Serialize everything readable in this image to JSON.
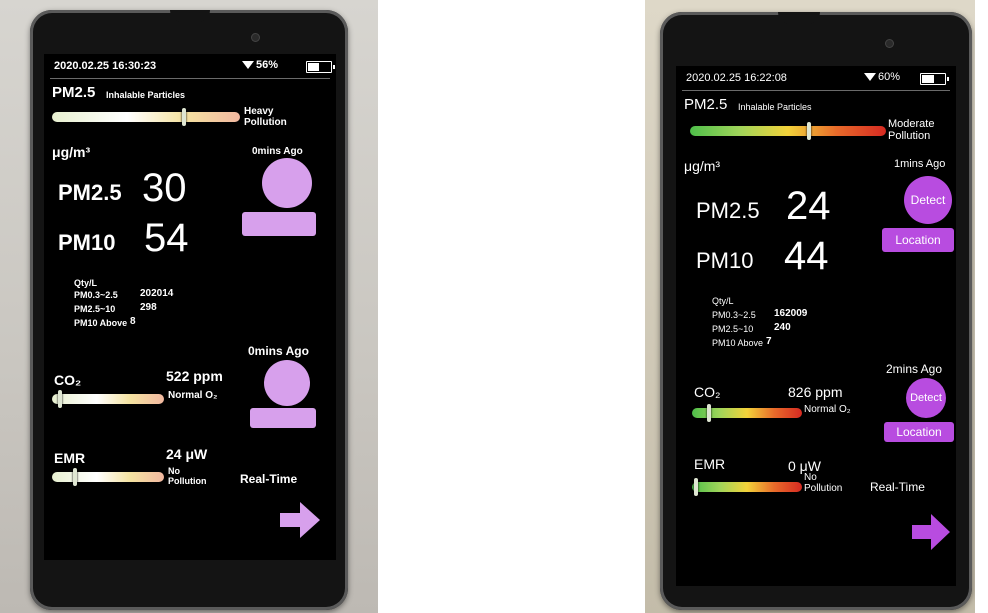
{
  "devices": [
    {
      "status": {
        "datetime": "2020.02.25  16:30:23",
        "battery": "56%",
        "battery_level": 0.56
      },
      "pm": {
        "header": "PM2.5",
        "header_sub": "Inhalable Particles",
        "level_text": "Heavy\nPollution",
        "gauge_level": 0.72,
        "unit": "μg/m³",
        "ago": "0mins Ago",
        "pm25_label": "PM2.5",
        "pm25_value": "30",
        "pm10_label": "PM10",
        "pm10_value": "54",
        "detect_label": "",
        "location_label": ""
      },
      "qty": {
        "title": "Qty/L",
        "rows": [
          {
            "label": "PM0.3~2.5",
            "value": "202014"
          },
          {
            "label": "PM2.5~10",
            "value": "298"
          },
          {
            "label": "PM10 Above",
            "value": "8"
          }
        ]
      },
      "co2": {
        "ago": "0mins Ago",
        "label": "CO₂",
        "value": "522 ppm",
        "level_text": "Normal O₂",
        "gauge_level": 0.06,
        "detect_label": "",
        "location_label": ""
      },
      "emr": {
        "label": "EMR",
        "value": "24 μW",
        "level_text": "No\nPollution",
        "gauge_level": 0.2,
        "realtime": "Real-Time"
      },
      "colors": {
        "accent": "#d7a0ec",
        "gauge": "pastel"
      }
    },
    {
      "status": {
        "datetime": "2020.02.25  16:22:08",
        "battery": "60%",
        "battery_level": 0.6
      },
      "pm": {
        "header": "PM2.5",
        "header_sub": "Inhalable Particles",
        "level_text": "Moderate\nPollution",
        "gauge_level": 0.62,
        "unit": "μg/m³",
        "ago": "1mins Ago",
        "pm25_label": "PM2.5",
        "pm25_value": "24",
        "pm10_label": "PM10",
        "pm10_value": "44",
        "detect_label": "Detect",
        "location_label": "Location"
      },
      "qty": {
        "title": "Qty/L",
        "rows": [
          {
            "label": "PM0.3~2.5",
            "value": "162009"
          },
          {
            "label": "PM2.5~10",
            "value": "240"
          },
          {
            "label": "PM10 Above",
            "value": "7"
          }
        ]
      },
      "co2": {
        "ago": "2mins Ago",
        "label": "CO₂",
        "value": "826 ppm",
        "level_text": "Normal O₂",
        "gauge_level": 0.15,
        "detect_label": "Detect",
        "location_label": "Location"
      },
      "emr": {
        "label": "EMR",
        "value": "0 μW",
        "level_text": "No\nPollution",
        "gauge_level": 0.02,
        "realtime": "Real-Time"
      },
      "colors": {
        "accent": "#b84ce0",
        "gauge": "green-yellow-red"
      }
    }
  ]
}
